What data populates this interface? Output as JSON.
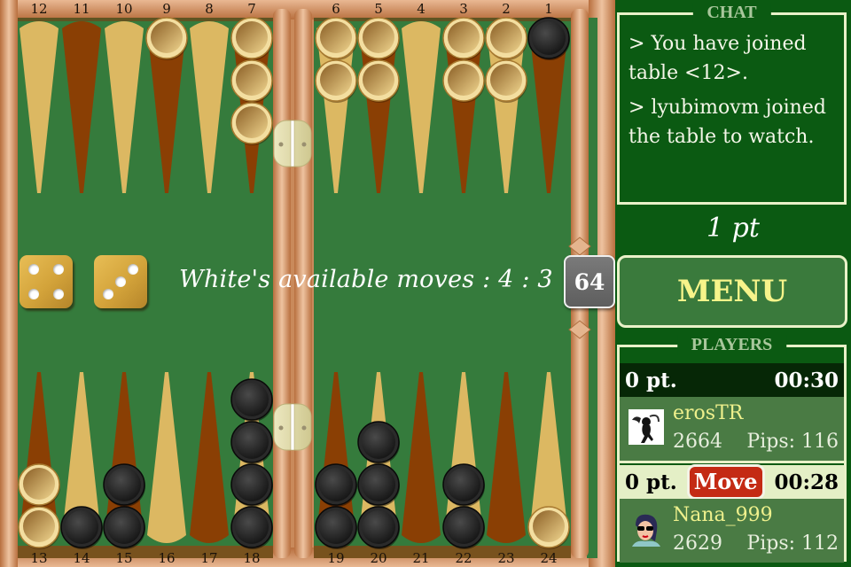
{
  "board": {
    "top_point_numbers": [
      "12",
      "11",
      "10",
      "9",
      "8",
      "7",
      "6",
      "5",
      "4",
      "3",
      "2",
      "1"
    ],
    "bottom_point_numbers": [
      "13",
      "14",
      "15",
      "16",
      "17",
      "18",
      "19",
      "20",
      "21",
      "22",
      "23",
      "24"
    ],
    "points": {
      "1": {
        "color": "black",
        "count": 1
      },
      "2": {
        "color": "white",
        "count": 2
      },
      "3": {
        "color": "white",
        "count": 2
      },
      "4": {
        "color": null,
        "count": 0
      },
      "5": {
        "color": "white",
        "count": 2
      },
      "6": {
        "color": "white",
        "count": 2
      },
      "7": {
        "color": "white",
        "count": 3
      },
      "8": {
        "color": null,
        "count": 0
      },
      "9": {
        "color": "white",
        "count": 1
      },
      "10": {
        "color": null,
        "count": 0
      },
      "11": {
        "color": null,
        "count": 0
      },
      "12": {
        "color": null,
        "count": 0
      },
      "13": {
        "color": "white",
        "count": 2
      },
      "14": {
        "color": "black",
        "count": 1
      },
      "15": {
        "color": "black",
        "count": 2
      },
      "16": {
        "color": null,
        "count": 0
      },
      "17": {
        "color": null,
        "count": 0
      },
      "18": {
        "color": "black",
        "count": 4
      },
      "19": {
        "color": "black",
        "count": 2
      },
      "20": {
        "color": "black",
        "count": 3
      },
      "21": {
        "color": null,
        "count": 0
      },
      "22": {
        "color": "black",
        "count": 2
      },
      "23": {
        "color": null,
        "count": 0
      },
      "24": {
        "color": "white",
        "count": 1
      }
    },
    "dice": [
      4,
      3
    ],
    "status_text": "White's available moves  : 4 : 3",
    "doubling_cube": "64",
    "colors": {
      "felt": "#357b3c",
      "point_light": "#dcb862",
      "point_dark": "#8a3f04",
      "frame": "#c98a5b"
    }
  },
  "sidebar": {
    "chat": {
      "title": "CHAT",
      "lines": [
        "> You have joined table <12>.",
        "> lyubimovm joined the table to watch."
      ]
    },
    "match_points": "1 pt",
    "menu_label": "MENU",
    "players": {
      "title": "PLAYERS",
      "list": [
        {
          "score": "0 pt.",
          "timer": "00:30",
          "name": "erosTR",
          "rating": "2664",
          "pips": "Pips: 116",
          "avatar": "cupid-avatar",
          "to_move": false
        },
        {
          "score": "0 pt.",
          "timer": "00:28",
          "name": "Nana_999",
          "rating": "2629",
          "pips": "Pips: 112",
          "avatar": "woman-sunglasses-avatar",
          "to_move": true,
          "move_badge": "Move"
        }
      ]
    }
  }
}
